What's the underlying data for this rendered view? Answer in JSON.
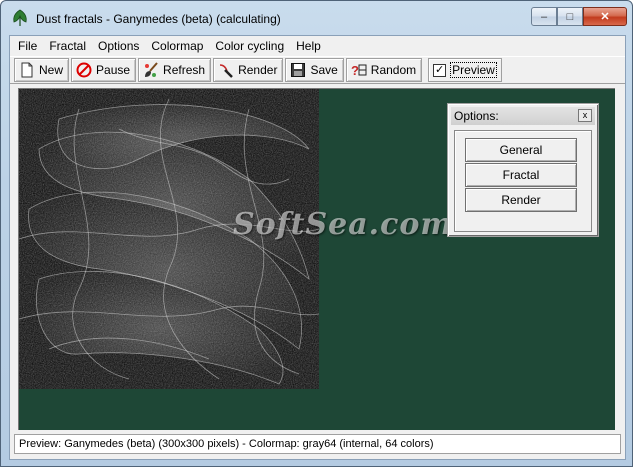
{
  "window": {
    "title": "Dust fractals - Ganymedes (beta)  (calculating)",
    "minimize_glyph": "–",
    "maximize_glyph": "□",
    "close_glyph": "✕"
  },
  "menu": [
    "File",
    "Fractal",
    "Options",
    "Colormap",
    "Color cycling",
    "Help"
  ],
  "toolbar": {
    "new_label": "New",
    "pause_label": "Pause",
    "refresh_label": "Refresh",
    "render_label": "Render",
    "save_label": "Save",
    "random_label": "Random",
    "preview_label": "Preview",
    "preview_checked": true
  },
  "options_panel": {
    "title": "Options:",
    "close_glyph": "x",
    "buttons": [
      "General",
      "Fractal",
      "Render"
    ]
  },
  "watermark": "SoftSea.com",
  "status": "Preview: Ganymedes (beta) (300x300 pixels)   -   Colormap: gray64 (internal, 64 colors)",
  "colors": {
    "canvas_background": "#1e4736",
    "fractal_background": "#000000",
    "window_chrome": "#c9dced"
  },
  "icons": {
    "app": "leaf-icon",
    "new": "new-document-icon",
    "pause": "stop-sign-icon",
    "refresh": "brush-icon",
    "render": "wand-icon",
    "save": "disk-icon",
    "random": "question-dice-icon"
  }
}
